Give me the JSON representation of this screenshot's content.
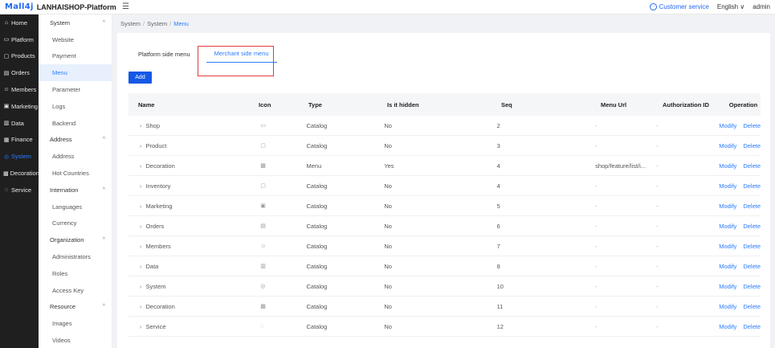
{
  "brand": {
    "logo": "Mall4j",
    "name": "LANHAISHOP-Platform"
  },
  "topbar": {
    "customer_service": "Customer service",
    "language": "English",
    "language_chevron": "∨",
    "user": "admin"
  },
  "sidebar": [
    {
      "label": "Home",
      "icon": "⌂",
      "active": false
    },
    {
      "label": "Platform",
      "icon": "▭",
      "active": false
    },
    {
      "label": "Products",
      "icon": "▢",
      "active": false
    },
    {
      "label": "Orders",
      "icon": "▤",
      "active": false
    },
    {
      "label": "Members",
      "icon": "☺",
      "active": false
    },
    {
      "label": "Marketing",
      "icon": "▣",
      "active": false
    },
    {
      "label": "Data",
      "icon": "▥",
      "active": false
    },
    {
      "label": "Finance",
      "icon": "▦",
      "active": false
    },
    {
      "label": "System",
      "icon": "◎",
      "active": true
    },
    {
      "label": "Decoration",
      "icon": "▩",
      "active": false
    },
    {
      "label": "Service",
      "icon": "◌",
      "active": false
    }
  ],
  "submenu": {
    "system_group": "System",
    "website": "Website",
    "payment": "Payment",
    "menu": "Menu",
    "parameter": "Parameter",
    "logs": "Logs",
    "backend": "Backend",
    "address_group": "Address",
    "address": "Address",
    "hot_countries": "Hot Countries",
    "internation_group": "Internation",
    "languages": "Languages",
    "currency": "Currency",
    "organization_group": "Organization",
    "administrators": "Administrators",
    "roles": "Roles",
    "access_key": "Access Key",
    "resource_group": "Resource",
    "images": "Images",
    "videos": "Videos"
  },
  "breadcrumb": {
    "first": "System",
    "second": "System",
    "current": "Menu",
    "sep": "/"
  },
  "tabs": {
    "platform": "Platform side menu",
    "merchant": "Merchant side menu"
  },
  "add_button": "Add",
  "table": {
    "headers": {
      "name": "Name",
      "icon": "Icon",
      "type": "Type",
      "hidden": "Is it hidden",
      "seq": "Seq",
      "url": "Menu Url",
      "auth": "Authorization ID",
      "op": "Operation"
    },
    "modify": "Modify",
    "delete": "Delete",
    "rows": [
      {
        "name": "Shop",
        "icon": "▭",
        "type": "Catalog",
        "hidden": "No",
        "seq": "2",
        "url": "-",
        "auth": "-"
      },
      {
        "name": "Product",
        "icon": "▢",
        "type": "Catalog",
        "hidden": "No",
        "seq": "3",
        "url": "-",
        "auth": "-"
      },
      {
        "name": "Decoration",
        "icon": "▩",
        "type": "Menu",
        "hidden": "Yes",
        "seq": "4",
        "url": "shop/feature/list/i...",
        "auth": "-"
      },
      {
        "name": "Inventory",
        "icon": "▢",
        "type": "Catalog",
        "hidden": "No",
        "seq": "4",
        "url": "-",
        "auth": "-"
      },
      {
        "name": "Marketing",
        "icon": "▣",
        "type": "Catalog",
        "hidden": "No",
        "seq": "5",
        "url": "-",
        "auth": "-"
      },
      {
        "name": "Orders",
        "icon": "▤",
        "type": "Catalog",
        "hidden": "No",
        "seq": "6",
        "url": "-",
        "auth": "-"
      },
      {
        "name": "Members",
        "icon": "☺",
        "type": "Catalog",
        "hidden": "No",
        "seq": "7",
        "url": "-",
        "auth": "-"
      },
      {
        "name": "Data",
        "icon": "▥",
        "type": "Catalog",
        "hidden": "No",
        "seq": "8",
        "url": "-",
        "auth": "-"
      },
      {
        "name": "System",
        "icon": "◎",
        "type": "Catalog",
        "hidden": "No",
        "seq": "10",
        "url": "-",
        "auth": "-"
      },
      {
        "name": "Decoration",
        "icon": "▩",
        "type": "Catalog",
        "hidden": "No",
        "seq": "11",
        "url": "-",
        "auth": "-"
      },
      {
        "name": "Service",
        "icon": "◌",
        "type": "Catalog",
        "hidden": "No",
        "seq": "12",
        "url": "-",
        "auth": "-"
      }
    ]
  },
  "colors": {
    "accent": "#2b7cff",
    "button": "#1558e6",
    "highlight_box": "#e03b3b",
    "sidebar_bg": "#1f1f1f"
  }
}
